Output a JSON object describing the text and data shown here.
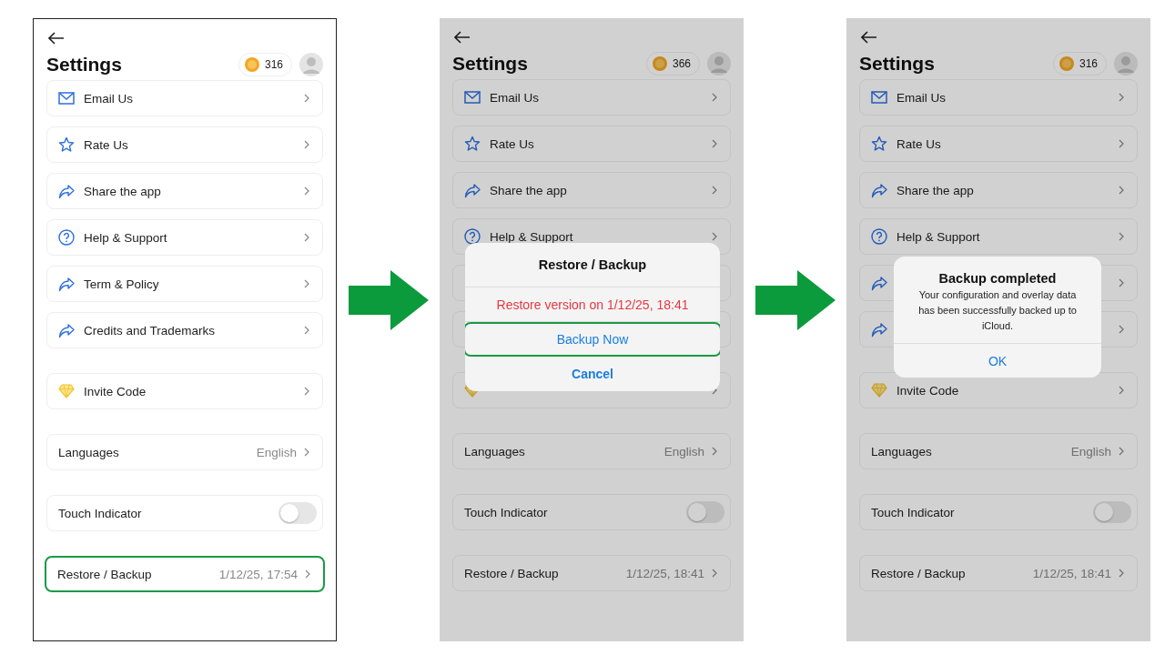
{
  "screens": [
    {
      "title": "Settings",
      "coins": "316",
      "dimmed": false,
      "groups": [
        [
          {
            "kind": "mail",
            "label": "Email Us",
            "chevron": true
          },
          {
            "kind": "star",
            "label": "Rate Us",
            "chevron": true
          },
          {
            "kind": "share",
            "label": "Share the app",
            "chevron": true
          },
          {
            "kind": "help",
            "label": "Help & Support",
            "chevron": true
          },
          {
            "kind": "share",
            "label": "Term & Policy",
            "chevron": true
          },
          {
            "kind": "share",
            "label": "Credits and Trademarks",
            "chevron": true
          }
        ],
        [
          {
            "kind": "diamond",
            "label": "Invite Code",
            "chevron": true
          }
        ],
        [
          {
            "kind": "plain",
            "label": "Languages",
            "value": "English",
            "chevron": true
          }
        ],
        [
          {
            "kind": "toggle",
            "label": "Touch Indicator",
            "on": false
          }
        ],
        [
          {
            "kind": "plain",
            "label": "Restore / Backup",
            "value": "1/12/25, 17:54",
            "chevron": true,
            "highlighted": true
          }
        ]
      ]
    },
    {
      "title": "Settings",
      "coins": "366",
      "dimmed": true,
      "groups": [
        [
          {
            "kind": "mail",
            "label": "Email Us",
            "chevron": true
          },
          {
            "kind": "star",
            "label": "Rate Us",
            "chevron": true
          },
          {
            "kind": "share",
            "label": "Share the app",
            "chevron": true
          },
          {
            "kind": "help",
            "label": "Help & Support",
            "chevron": true
          },
          {
            "kind": "plain",
            "chevron": false
          },
          {
            "kind": "plain",
            "chevron": false
          }
        ],
        [
          {
            "kind": "diamond",
            "chevron": true
          }
        ],
        [
          {
            "kind": "plain",
            "label": "Languages",
            "value": "English",
            "chevron": true
          }
        ],
        [
          {
            "kind": "toggle",
            "label": "Touch Indicator",
            "on": false
          }
        ],
        [
          {
            "kind": "plain",
            "label": "Restore / Backup",
            "value": "1/12/25, 18:41",
            "chevron": true,
            "highlighted": false
          }
        ]
      ],
      "dialog": {
        "kind": "actions",
        "title": "Restore / Backup",
        "actions": [
          {
            "label": "Restore version on 1/12/25, 18:41",
            "kind": "destructive",
            "highlighted": false
          },
          {
            "label": "Backup Now",
            "kind": "default",
            "highlighted": true
          },
          {
            "label": "Cancel",
            "kind": "cancel",
            "highlighted": false
          }
        ]
      }
    },
    {
      "title": "Settings",
      "coins": "316",
      "dimmed": true,
      "groups": [
        [
          {
            "kind": "mail",
            "label": "Email Us",
            "chevron": true
          },
          {
            "kind": "star",
            "label": "Rate Us",
            "chevron": true
          },
          {
            "kind": "share",
            "label": "Share the app",
            "chevron": true
          },
          {
            "kind": "help",
            "label": "Help & Support",
            "chevron": true
          },
          {
            "kind": "share",
            "chevron": true
          },
          {
            "kind": "share",
            "chevron": true
          }
        ],
        [
          {
            "kind": "diamond",
            "label": "Invite Code",
            "chevron": true
          }
        ],
        [
          {
            "kind": "plain",
            "label": "Languages",
            "value": "English",
            "chevron": true
          }
        ],
        [
          {
            "kind": "toggle",
            "label": "Touch Indicator",
            "on": false
          }
        ],
        [
          {
            "kind": "plain",
            "label": "Restore / Backup",
            "value": "1/12/25, 18:41",
            "chevron": true,
            "highlighted": false
          }
        ]
      ],
      "dialog": {
        "kind": "alert",
        "title": "Backup completed",
        "message": "Your configuration and overlay data has been successfully backed up to iCloud.",
        "actions": [
          {
            "label": "OK",
            "kind": "default",
            "highlighted": false
          }
        ]
      }
    }
  ]
}
